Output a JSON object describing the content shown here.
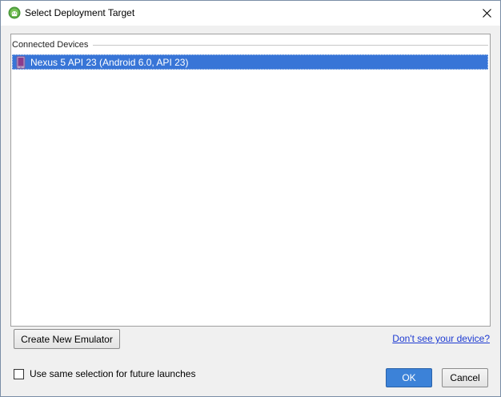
{
  "window": {
    "title": "Select Deployment Target"
  },
  "device_list": {
    "group_label": "Connected Devices",
    "devices": [
      {
        "label": "Nexus 5 API 23 (Android 6.0, API 23)",
        "selected": true
      }
    ]
  },
  "footer": {
    "create_emulator_label": "Create New Emulator",
    "help_link_label": "Don't see your device?",
    "remember_checkbox_label": "Use same selection for future launches",
    "remember_checked": false,
    "ok_label": "OK",
    "cancel_label": "Cancel"
  },
  "icons": {
    "app": "android-studio-icon",
    "close": "close-icon",
    "device": "phone-icon"
  },
  "colors": {
    "selection": "#3875d7",
    "ok_button": "#3c82d8",
    "link": "#1e3bd2"
  }
}
